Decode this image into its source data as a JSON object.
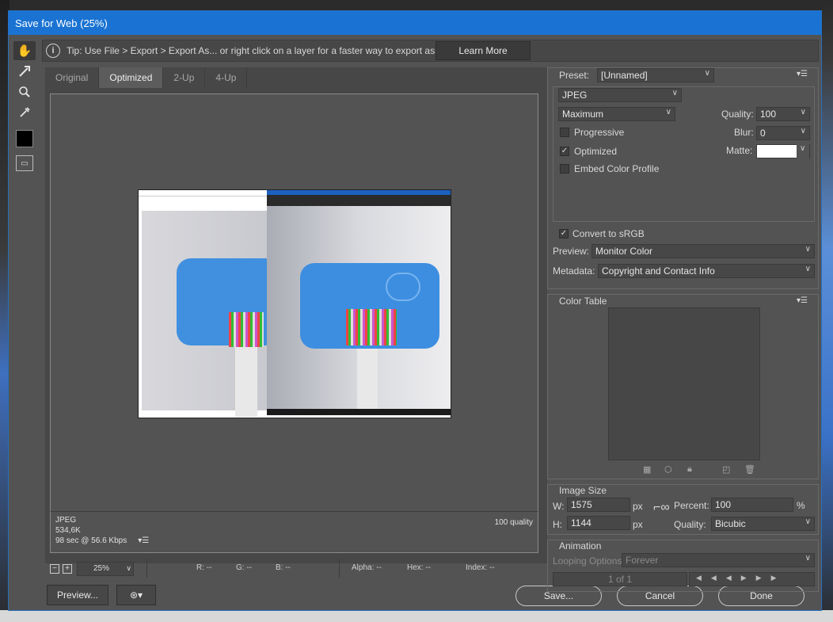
{
  "window": {
    "title": "Save for Web (25%)"
  },
  "tip": {
    "text": "Tip: Use File > Export > Export As...  or right click on a layer for a faster way to export assets",
    "learn_more": "Learn More"
  },
  "tabs": [
    "Original",
    "Optimized",
    "2-Up",
    "4-Up"
  ],
  "preview_info": {
    "format": "JPEG",
    "size": "534,6K",
    "time": "98 sec @ 56.6 Kbps",
    "quality": "100 quality"
  },
  "status": {
    "zoom": "25%",
    "r": "R: --",
    "g": "G: --",
    "b": "B: --",
    "alpha": "Alpha: --",
    "hex": "Hex: --",
    "index": "Index: --"
  },
  "buttons": {
    "preview": "Preview...",
    "save": "Save...",
    "cancel": "Cancel",
    "done": "Done"
  },
  "settings": {
    "preset_label": "Preset:",
    "preset_value": "[Unnamed]",
    "format": "JPEG",
    "compression": "Maximum",
    "quality_label": "Quality:",
    "quality_value": "100",
    "progressive": "Progressive",
    "blur_label": "Blur:",
    "blur_value": "0",
    "optimized": "Optimized",
    "matte_label": "Matte:",
    "embed_profile": "Embed Color Profile",
    "convert_srgb": "Convert to sRGB",
    "preview_label": "Preview:",
    "preview_value": "Monitor Color",
    "metadata_label": "Metadata:",
    "metadata_value": "Copyright and Contact Info"
  },
  "color_table": {
    "title": "Color Table"
  },
  "image_size": {
    "title": "Image Size",
    "w_label": "W:",
    "w_value": "1575",
    "h_label": "H:",
    "h_value": "1144",
    "px": "px",
    "percent_label": "Percent:",
    "percent_value": "100",
    "percent_unit": "%",
    "quality_label": "Quality:",
    "quality_value": "Bicubic"
  },
  "animation": {
    "title": "Animation",
    "looping_label": "Looping Options:",
    "looping_value": "Forever",
    "frame": "1 of 1"
  }
}
